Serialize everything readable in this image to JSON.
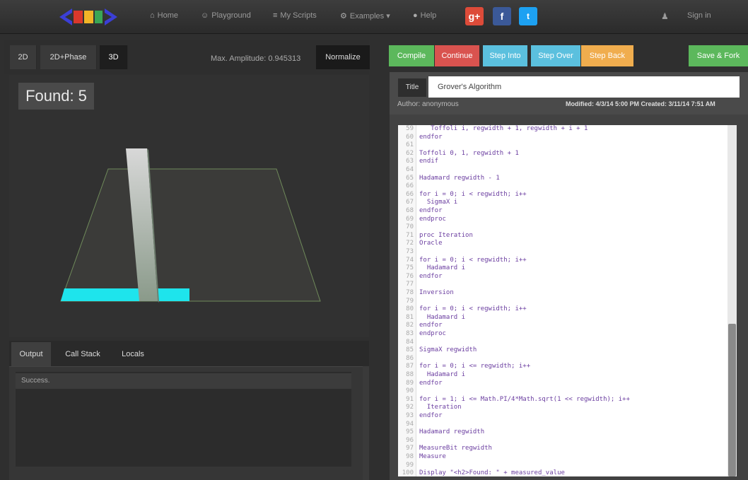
{
  "nav": {
    "items": [
      {
        "icon": "home-icon",
        "glyph": "⌂",
        "label": "Home",
        "x": 0
      },
      {
        "icon": "user-icon",
        "glyph": "☺",
        "label": "Playground"
      },
      {
        "icon": "list-icon",
        "glyph": "≡",
        "label": "My Scripts"
      },
      {
        "icon": "gear-icon",
        "glyph": "⚙",
        "label": "Examples ▾"
      },
      {
        "icon": "help-icon",
        "glyph": "●",
        "label": "Help"
      }
    ],
    "signin": "Sign in",
    "social": [
      "g+",
      "f",
      "t"
    ]
  },
  "viz": {
    "tabs": [
      "2D",
      "2D+Phase",
      "3D"
    ],
    "max_amplitude": "Max. Amplitude: 0.945313",
    "normalize": "Normalize",
    "found": "Found: 5"
  },
  "output": {
    "tabs": [
      "Output",
      "Call Stack",
      "Locals"
    ],
    "message": "Success."
  },
  "toolbar": {
    "compile": "Compile",
    "continue": "Continue",
    "step_into": "Step Into",
    "step_over": "Step Over",
    "step_back": "Step Back",
    "save_fork": "Save & Fork",
    "colors": {
      "compile": "#5cb85c",
      "continue": "#d9534f",
      "step_into": "#5bc0de",
      "step_over": "#5bc0de",
      "step_back": "#f0ad4e",
      "save_fork": "#5cb85c"
    }
  },
  "script": {
    "title_label": "Title",
    "title": "Grover's Algorithm",
    "author": "Author: anonymous",
    "meta": "Modified: 4/3/14 5:00 PM    Created: 3/11/14 7:51 AM"
  },
  "code": [
    {
      "n": "59",
      "t": "   Toffoli i, regwidth + 1, regwidth + i + 1"
    },
    {
      "n": "60",
      "t": "endfor"
    },
    {
      "n": "61",
      "t": ""
    },
    {
      "n": "62",
      "t": "Toffoli 0, 1, regwidth + 1"
    },
    {
      "n": "63",
      "t": "endif"
    },
    {
      "n": "64",
      "t": ""
    },
    {
      "n": "65",
      "t": "Hadamard regwidth - 1"
    },
    {
      "n": "66",
      "t": ""
    },
    {
      "n": "66",
      "t": "for i = 0; i < regwidth; i++"
    },
    {
      "n": "67",
      "t": "  SigmaX i"
    },
    {
      "n": "68",
      "t": "endfor"
    },
    {
      "n": "69",
      "t": "endproc"
    },
    {
      "n": "70",
      "t": ""
    },
    {
      "n": "71",
      "t": "proc Iteration"
    },
    {
      "n": "72",
      "t": "Oracle"
    },
    {
      "n": "73",
      "t": ""
    },
    {
      "n": "74",
      "t": "for i = 0; i < regwidth; i++"
    },
    {
      "n": "75",
      "t": "  Hadamard i"
    },
    {
      "n": "76",
      "t": "endfor"
    },
    {
      "n": "77",
      "t": ""
    },
    {
      "n": "78",
      "t": "Inversion"
    },
    {
      "n": "79",
      "t": ""
    },
    {
      "n": "80",
      "t": "for i = 0; i < regwidth; i++"
    },
    {
      "n": "81",
      "t": "  Hadamard i"
    },
    {
      "n": "82",
      "t": "endfor"
    },
    {
      "n": "83",
      "t": "endproc"
    },
    {
      "n": "84",
      "t": ""
    },
    {
      "n": "85",
      "t": "SigmaX regwidth"
    },
    {
      "n": "86",
      "t": ""
    },
    {
      "n": "87",
      "t": "for i = 0; i <= regwidth; i++"
    },
    {
      "n": "88",
      "t": "  Hadamard i"
    },
    {
      "n": "89",
      "t": "endfor"
    },
    {
      "n": "90",
      "t": ""
    },
    {
      "n": "91",
      "t": "for i = 1; i <= Math.PI/4*Math.sqrt(1 << regwidth); i++"
    },
    {
      "n": "92",
      "t": "  Iteration"
    },
    {
      "n": "93",
      "t": "endfor"
    },
    {
      "n": "94",
      "t": ""
    },
    {
      "n": "95",
      "t": "Hadamard regwidth"
    },
    {
      "n": "96",
      "t": ""
    },
    {
      "n": "97",
      "t": "MeasureBit regwidth"
    },
    {
      "n": "98",
      "t": "Measure"
    },
    {
      "n": "99",
      "t": ""
    },
    {
      "n": "100",
      "t": "Display \"<h2>Found: \" + measured_value"
    }
  ]
}
